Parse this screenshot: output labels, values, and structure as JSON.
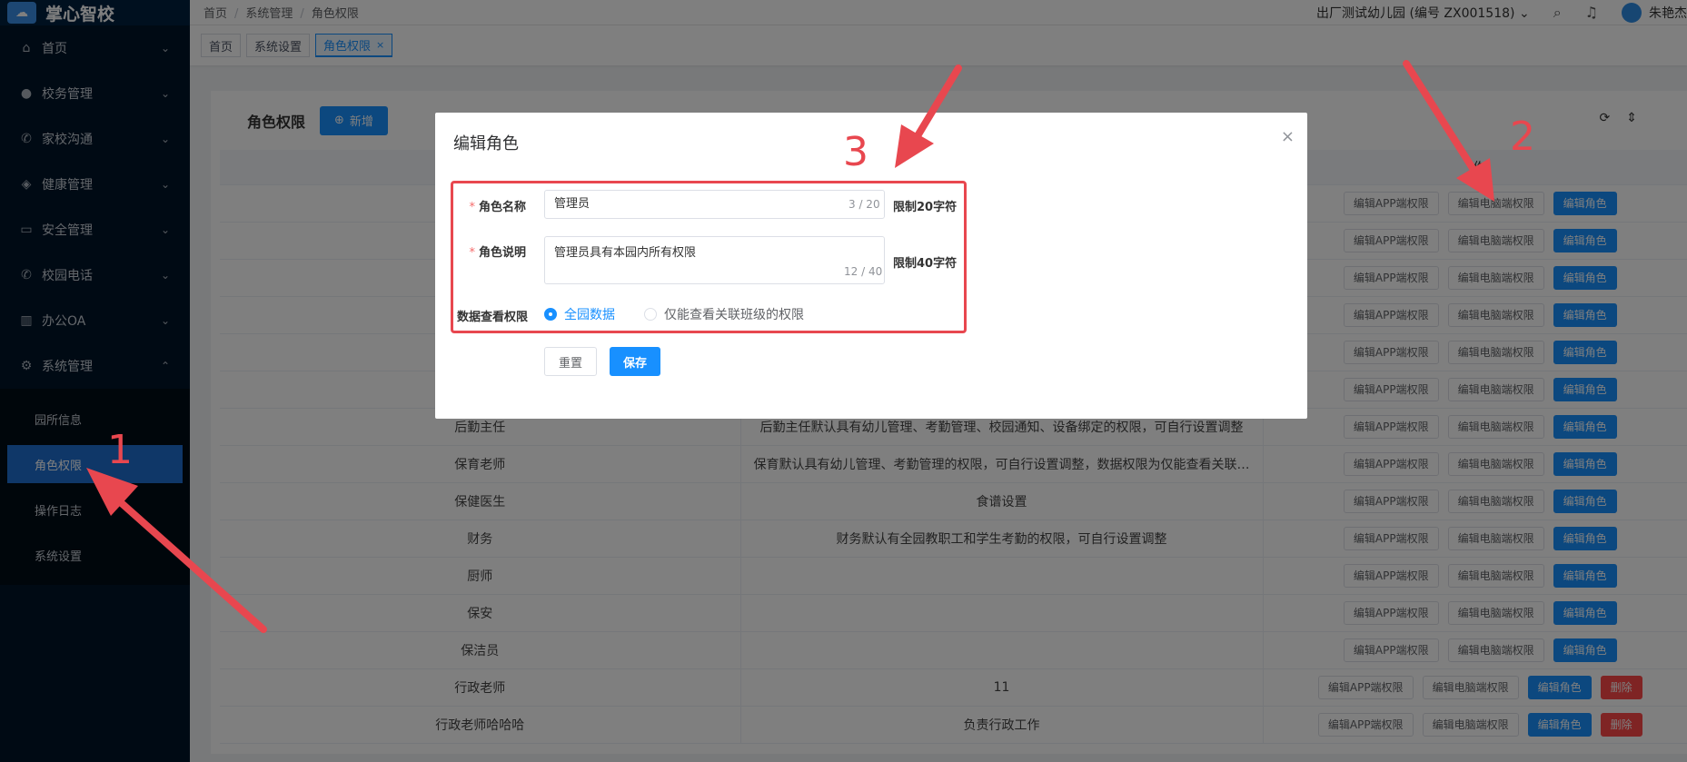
{
  "app": {
    "name": "掌心智校",
    "logo_icon": "logo-icon"
  },
  "sidebar": {
    "items": [
      {
        "label": "首页",
        "icon": "home-icon"
      },
      {
        "label": "校务管理",
        "icon": "user-icon"
      },
      {
        "label": "家校沟通",
        "icon": "phone-icon"
      },
      {
        "label": "健康管理",
        "icon": "shield-icon"
      },
      {
        "label": "安全管理",
        "icon": "folder-icon"
      },
      {
        "label": "校园电话",
        "icon": "phone-icon"
      },
      {
        "label": "办公OA",
        "icon": "chart-icon"
      },
      {
        "label": "系统管理",
        "icon": "gear-icon"
      }
    ],
    "sub_items": [
      "园所信息",
      "角色权限",
      "操作日志",
      "系统设置"
    ]
  },
  "breadcrumb": [
    "首页",
    "系统管理",
    "角色权限"
  ],
  "topbar": {
    "school": "出厂测试幼儿园 (编号 ZX001518)",
    "user": "朱艳杰"
  },
  "tabs": [
    {
      "label": "首页"
    },
    {
      "label": "系统设置"
    },
    {
      "label": "角色权限",
      "close": "×"
    }
  ],
  "page": {
    "title": "角色权限",
    "add_label": "新增",
    "ops_header": "作"
  },
  "table": {
    "rows": [
      {
        "name": "",
        "desc": "",
        "app": "编辑APP端权限",
        "pc": "编辑电脑端权限",
        "edit": "编辑角色"
      },
      {
        "name": "",
        "desc": "",
        "app": "编辑APP端权限",
        "pc": "编辑电脑端权限",
        "edit": "编辑角色"
      },
      {
        "name": "",
        "desc": "",
        "app": "编辑APP端权限",
        "pc": "编辑电脑端权限",
        "edit": "编辑角色"
      },
      {
        "name": "",
        "desc": "",
        "app": "编辑APP端权限",
        "pc": "编辑电脑端权限",
        "edit": "编辑角色"
      },
      {
        "name": "",
        "desc": "",
        "app": "编辑APP端权限",
        "pc": "编辑电脑端权限",
        "edit": "编辑角色"
      },
      {
        "name": "",
        "desc": "",
        "app": "编辑APP端权限",
        "pc": "编辑电脑端权限",
        "edit": "编辑角色"
      },
      {
        "name": "后勤主任",
        "desc": "后勤主任默认具有幼儿管理、考勤管理、校园通知、设备绑定的权限，可自行设置调整",
        "app": "编辑APP端权限",
        "pc": "编辑电脑端权限",
        "edit": "编辑角色"
      },
      {
        "name": "保育老师",
        "desc": "保育默认具有幼儿管理、考勤管理的权限，可自行设置调整，数据权限为仅能查看关联…",
        "app": "编辑APP端权限",
        "pc": "编辑电脑端权限",
        "edit": "编辑角色"
      },
      {
        "name": "保健医生",
        "desc": "食谱设置",
        "app": "编辑APP端权限",
        "pc": "编辑电脑端权限",
        "edit": "编辑角色"
      },
      {
        "name": "财务",
        "desc": "财务默认有全园教职工和学生考勤的权限，可自行设置调整",
        "app": "编辑APP端权限",
        "pc": "编辑电脑端权限",
        "edit": "编辑角色"
      },
      {
        "name": "厨师",
        "desc": "",
        "app": "编辑APP端权限",
        "pc": "编辑电脑端权限",
        "edit": "编辑角色"
      },
      {
        "name": "保安",
        "desc": "",
        "app": "编辑APP端权限",
        "pc": "编辑电脑端权限",
        "edit": "编辑角色"
      },
      {
        "name": "保洁员",
        "desc": "",
        "app": "编辑APP端权限",
        "pc": "编辑电脑端权限",
        "edit": "编辑角色"
      },
      {
        "name": "行政老师",
        "desc": "11",
        "app": "编辑APP端权限",
        "pc": "编辑电脑端权限",
        "edit": "编辑角色",
        "del": "删除"
      },
      {
        "name": "行政老师哈哈哈",
        "desc": "负责行政工作",
        "app": "编辑APP端权限",
        "pc": "编辑电脑端权限",
        "edit": "编辑角色",
        "del": "删除"
      }
    ]
  },
  "modal": {
    "title": "编辑角色",
    "name_label": "角色名称",
    "name_value": "管理员",
    "name_count": "3 / 20",
    "name_limit": "限制20字符",
    "desc_label": "角色说明",
    "desc_value": "管理员具有本园内所有权限",
    "desc_count": "12 / 40",
    "desc_limit": "限制40字符",
    "scope_label": "数据查看权限",
    "scope_option_all": "全园数据",
    "scope_option_class": "仅能查看关联班级的权限",
    "scope_selected": "全园数据",
    "reset_label": "重置",
    "save_label": "保存",
    "close": "×"
  },
  "annotations": {
    "n1": "1",
    "n2": "2",
    "n3": "3",
    "color": "#e8474f"
  },
  "colors": {
    "primary": "#1890ff",
    "danger": "#ff4949",
    "sidebar": "#001529"
  }
}
